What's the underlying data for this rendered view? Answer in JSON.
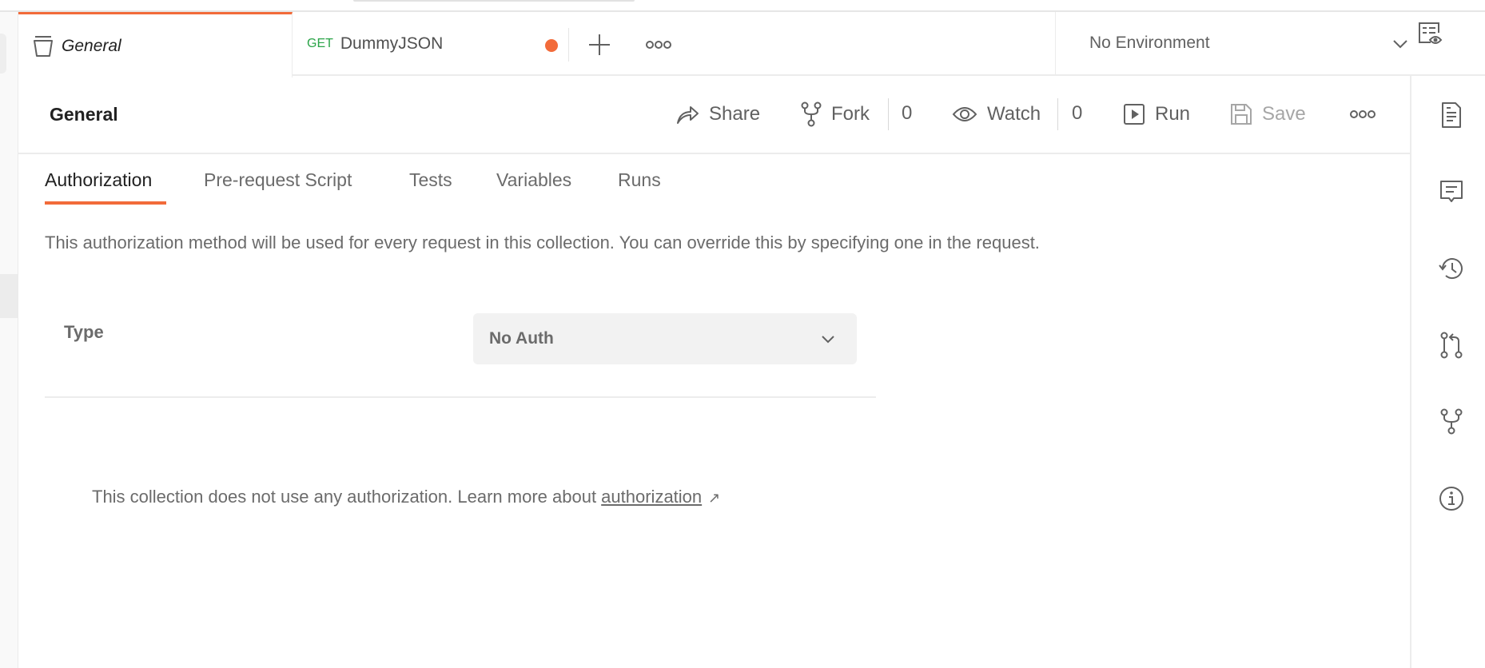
{
  "tabs": {
    "active": {
      "label": "General",
      "icon": "collection-icon"
    },
    "request": {
      "method": "GET",
      "label": "DummyJSON",
      "unsaved": true
    },
    "new_tab_icon": "plus-icon",
    "more_icon": "ellipsis-icon"
  },
  "environment": {
    "selected": "No Environment",
    "icon": "chevron-down-icon",
    "quick_look_icon": "environment-quick-look-icon"
  },
  "header": {
    "title": "General",
    "share_label": "Share",
    "fork_label": "Fork",
    "fork_count": "0",
    "watch_label": "Watch",
    "watch_count": "0",
    "run_label": "Run",
    "save_label": "Save"
  },
  "subtabs": [
    {
      "label": "Authorization",
      "active": true
    },
    {
      "label": "Pre-request Script"
    },
    {
      "label": "Tests"
    },
    {
      "label": "Variables"
    },
    {
      "label": "Runs"
    }
  ],
  "authorization": {
    "description": "This authorization method will be used for every request in this collection. You can override this by specifying one in the request.",
    "type_label": "Type",
    "type_value": "No Auth",
    "note_prefix": "This collection does not use any authorization. Learn more about ",
    "note_link": "authorization",
    "note_link_suffix": "↗"
  },
  "right_sidebar": {
    "items": [
      "documentation-icon",
      "comments-icon",
      "changelog-icon",
      "pull-requests-icon",
      "forks-icon",
      "info-icon"
    ]
  },
  "colors": {
    "accent": "#f26b3a",
    "get_method": "#2aa448",
    "text_muted": "#6b6b6b"
  }
}
